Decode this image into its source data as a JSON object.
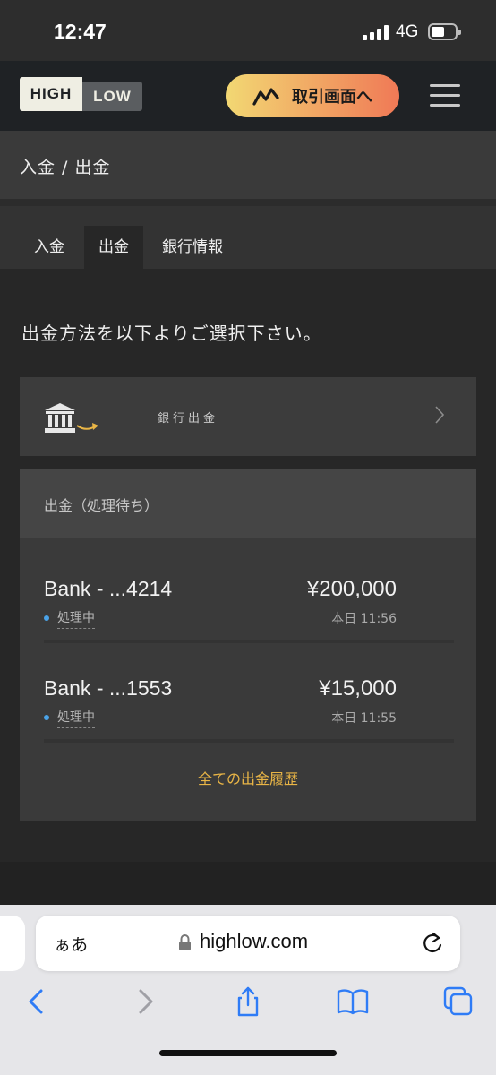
{
  "status_bar": {
    "time": "12:47",
    "network": "4G",
    "icons": [
      "signal-bars-icon",
      "battery-icon"
    ]
  },
  "header": {
    "logo_high": "HIGH",
    "logo_low": "LOW",
    "trade_button_label": "取引画面へ",
    "trade_icon": "zigzag-chart-icon",
    "menu_icon": "hamburger-menu-icon"
  },
  "breadcrumb": {
    "text": "入金 / 出金"
  },
  "tabs": [
    {
      "label": "入金",
      "active": false
    },
    {
      "label": "出金",
      "active": true
    },
    {
      "label": "銀行情報",
      "active": false
    }
  ],
  "main": {
    "instruction": "出金方法を以下よりご選択下さい。",
    "method": {
      "label": "銀行出金",
      "icon": "bank-building-icon"
    },
    "pending": {
      "title": "出金（処理待ち）",
      "items": [
        {
          "name": "Bank - ...4214",
          "amount": "¥200,000",
          "status": "処理中",
          "time": "本日 11:56"
        },
        {
          "name": "Bank - ...1553",
          "amount": "¥15,000",
          "status": "処理中",
          "time": "本日 11:55"
        }
      ],
      "history_link": "全ての出金履歴"
    }
  },
  "browser": {
    "aa_label": "ぁあ",
    "url": "highlow.com",
    "toolbar_icons": [
      "back-icon",
      "forward-icon",
      "share-icon",
      "bookmarks-icon",
      "tabs-icon"
    ]
  },
  "colors": {
    "accent_gold": "#e9b546",
    "status_blue": "#4aa3e8",
    "safari_blue": "#2f7cf6"
  }
}
